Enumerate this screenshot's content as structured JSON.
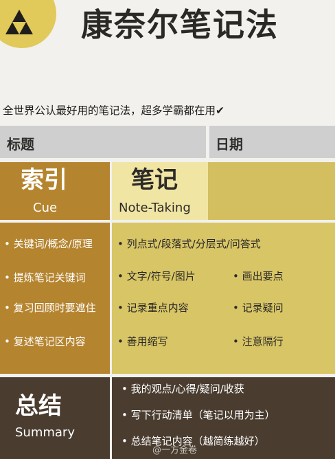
{
  "header": {
    "title": "康奈尔笔记法"
  },
  "subtitle": "全世界公认最好用的笔记法，超多学霸都在用✔",
  "bar": {
    "title_label": "标题",
    "date_label": "日期"
  },
  "cue": {
    "title": "索引",
    "subtitle": "Cue",
    "items": [
      "• 关键词/概念/原理",
      "• 提炼笔记关键词",
      "• 复习回顾时要遮住",
      "• 复述笔记区内容"
    ]
  },
  "notes": {
    "title": "笔记",
    "subtitle": "Note-Taking",
    "items": [
      "• 列点式/段落式/分层式/问答式",
      "• 文字/符号/图片",
      "• 画出要点",
      "• 记录重点内容",
      "• 记录疑问",
      "• 善用缩写",
      "• 注意隔行"
    ]
  },
  "summary": {
    "title": "总结",
    "subtitle": "Summary",
    "items": [
      "• 我的观点/心得/疑问/收获",
      "• 写下行动清单（笔记以用为主）",
      "• 总结笔记内容（越简练越好）"
    ]
  },
  "watermark": "@一方金卷",
  "colors": {
    "logo": "#e1c95a",
    "cue": "#b5842f",
    "notes": "#d8c566",
    "notes_head_left": "#f1e5a4",
    "summary": "#4a3d30",
    "bar": "#cfcfcf"
  }
}
